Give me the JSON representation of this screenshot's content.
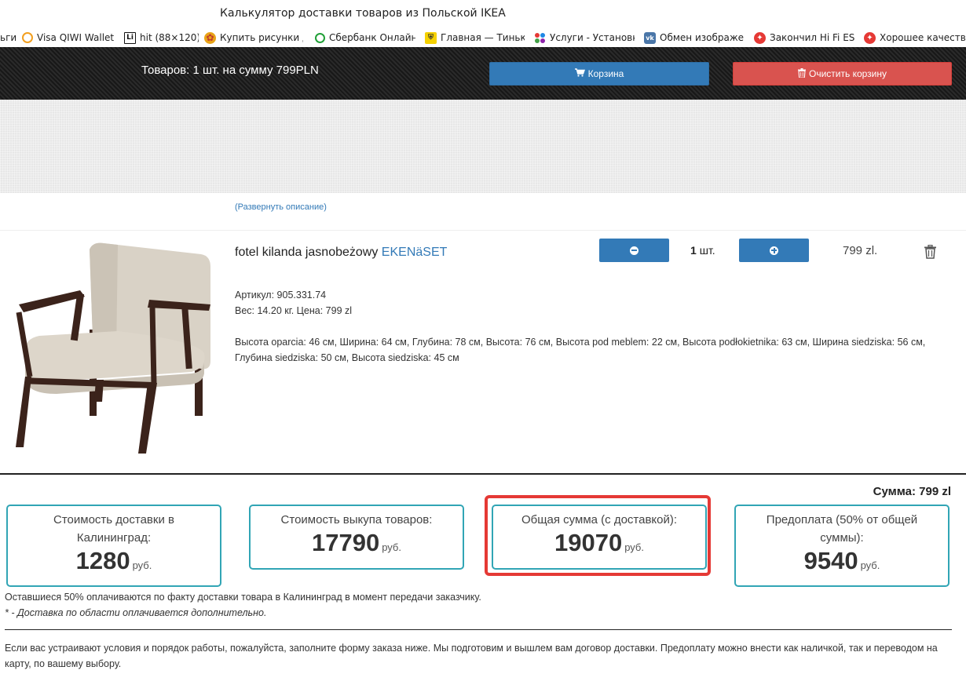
{
  "browser": {
    "title": "Калькулятор доставки товаров из Польской IKEA",
    "bookmarks": [
      {
        "label": "ьги",
        "icon": ""
      },
      {
        "label": "Visa QIWI Wallet",
        "icon": "qiwi-icon",
        "color": "#f29f1f"
      },
      {
        "label": "hit (88×120)",
        "icon": "liveinternet-icon",
        "color": "#222222"
      },
      {
        "label": "Купить рисунки д",
        "icon": "flower-icon",
        "color": "#e8a317"
      },
      {
        "label": "Сбербанк Онлайн",
        "icon": "sberbank-icon",
        "color": "#21a038"
      },
      {
        "label": "Главная — Тинько",
        "icon": "tinkoff-icon",
        "color": "#333333"
      },
      {
        "label": "Услуги - Установка",
        "icon": "services-icon",
        "color": "#8a5cd6"
      },
      {
        "label": "Обмен изображе",
        "icon": "vk-icon",
        "color": "#4a76a8"
      },
      {
        "label": "Закончил Hi Fi ES",
        "icon": "red-star-icon",
        "color": "#e53935"
      },
      {
        "label": "Хорошее качество",
        "icon": "red-star-icon",
        "color": "#e53935"
      }
    ]
  },
  "cart_bar": {
    "summary": "Товаров: 1 шт. на сумму 799PLN",
    "cart_button": "Корзина",
    "clear_button": "Очистить корзину"
  },
  "expand_link": "(Развернуть описание)",
  "product": {
    "name": "fotel kilanda jasnobeżowy",
    "brand": "EKENäSET",
    "qty_value": "1",
    "qty_unit": "шт.",
    "price": "799 zl.",
    "article_line": "Артикул: 905.331.74",
    "weight_line": "Вес: 14.20 кг. Цена: 799 zl",
    "dimensions": "Высота oparcia:  46 см, Ширина:  64 см, Глубина:  78 см, Высота:  76 см, Высота pod meblem:  22 см, Высота podłokietnika:  63 см, Ширина siedziska:  56 см, Глубина siedziska:  50 см, Высота siedziska:  45 см"
  },
  "total_sum": "Сумма: 799 zl",
  "cards": {
    "delivery": {
      "label": "Стоимость доставки в Калининград:",
      "value": "1280",
      "currency": "руб."
    },
    "purchase": {
      "label": "Стоимость выкупа товаров:",
      "value": "17790",
      "currency": "руб."
    },
    "total": {
      "label": "Общая сумма (с доставкой):",
      "value": "19070",
      "currency": "руб."
    },
    "prepay": {
      "label": "Предоплата (50% от общей суммы):",
      "value": "9540",
      "currency": "руб."
    }
  },
  "notes": {
    "remaining": "Оставшиеся 50% оплачиваются по факту доставки товара в Калининград в момент передачи заказчику.",
    "region": "* - Доставка по области оплачивается дополнительно."
  },
  "footer_text": "Если вас устраивают условия и порядок работы, пожалуйста, заполните форму заказа ниже. Мы подготовим и вышлем вам договор доставки. Предоплату можно внести как наличкой, так и переводом на карту, по вашему выбору.",
  "colors": {
    "primary": "#337ab7",
    "danger": "#d9534f",
    "card_border": "#31a5b5",
    "highlight": "#e53935"
  }
}
